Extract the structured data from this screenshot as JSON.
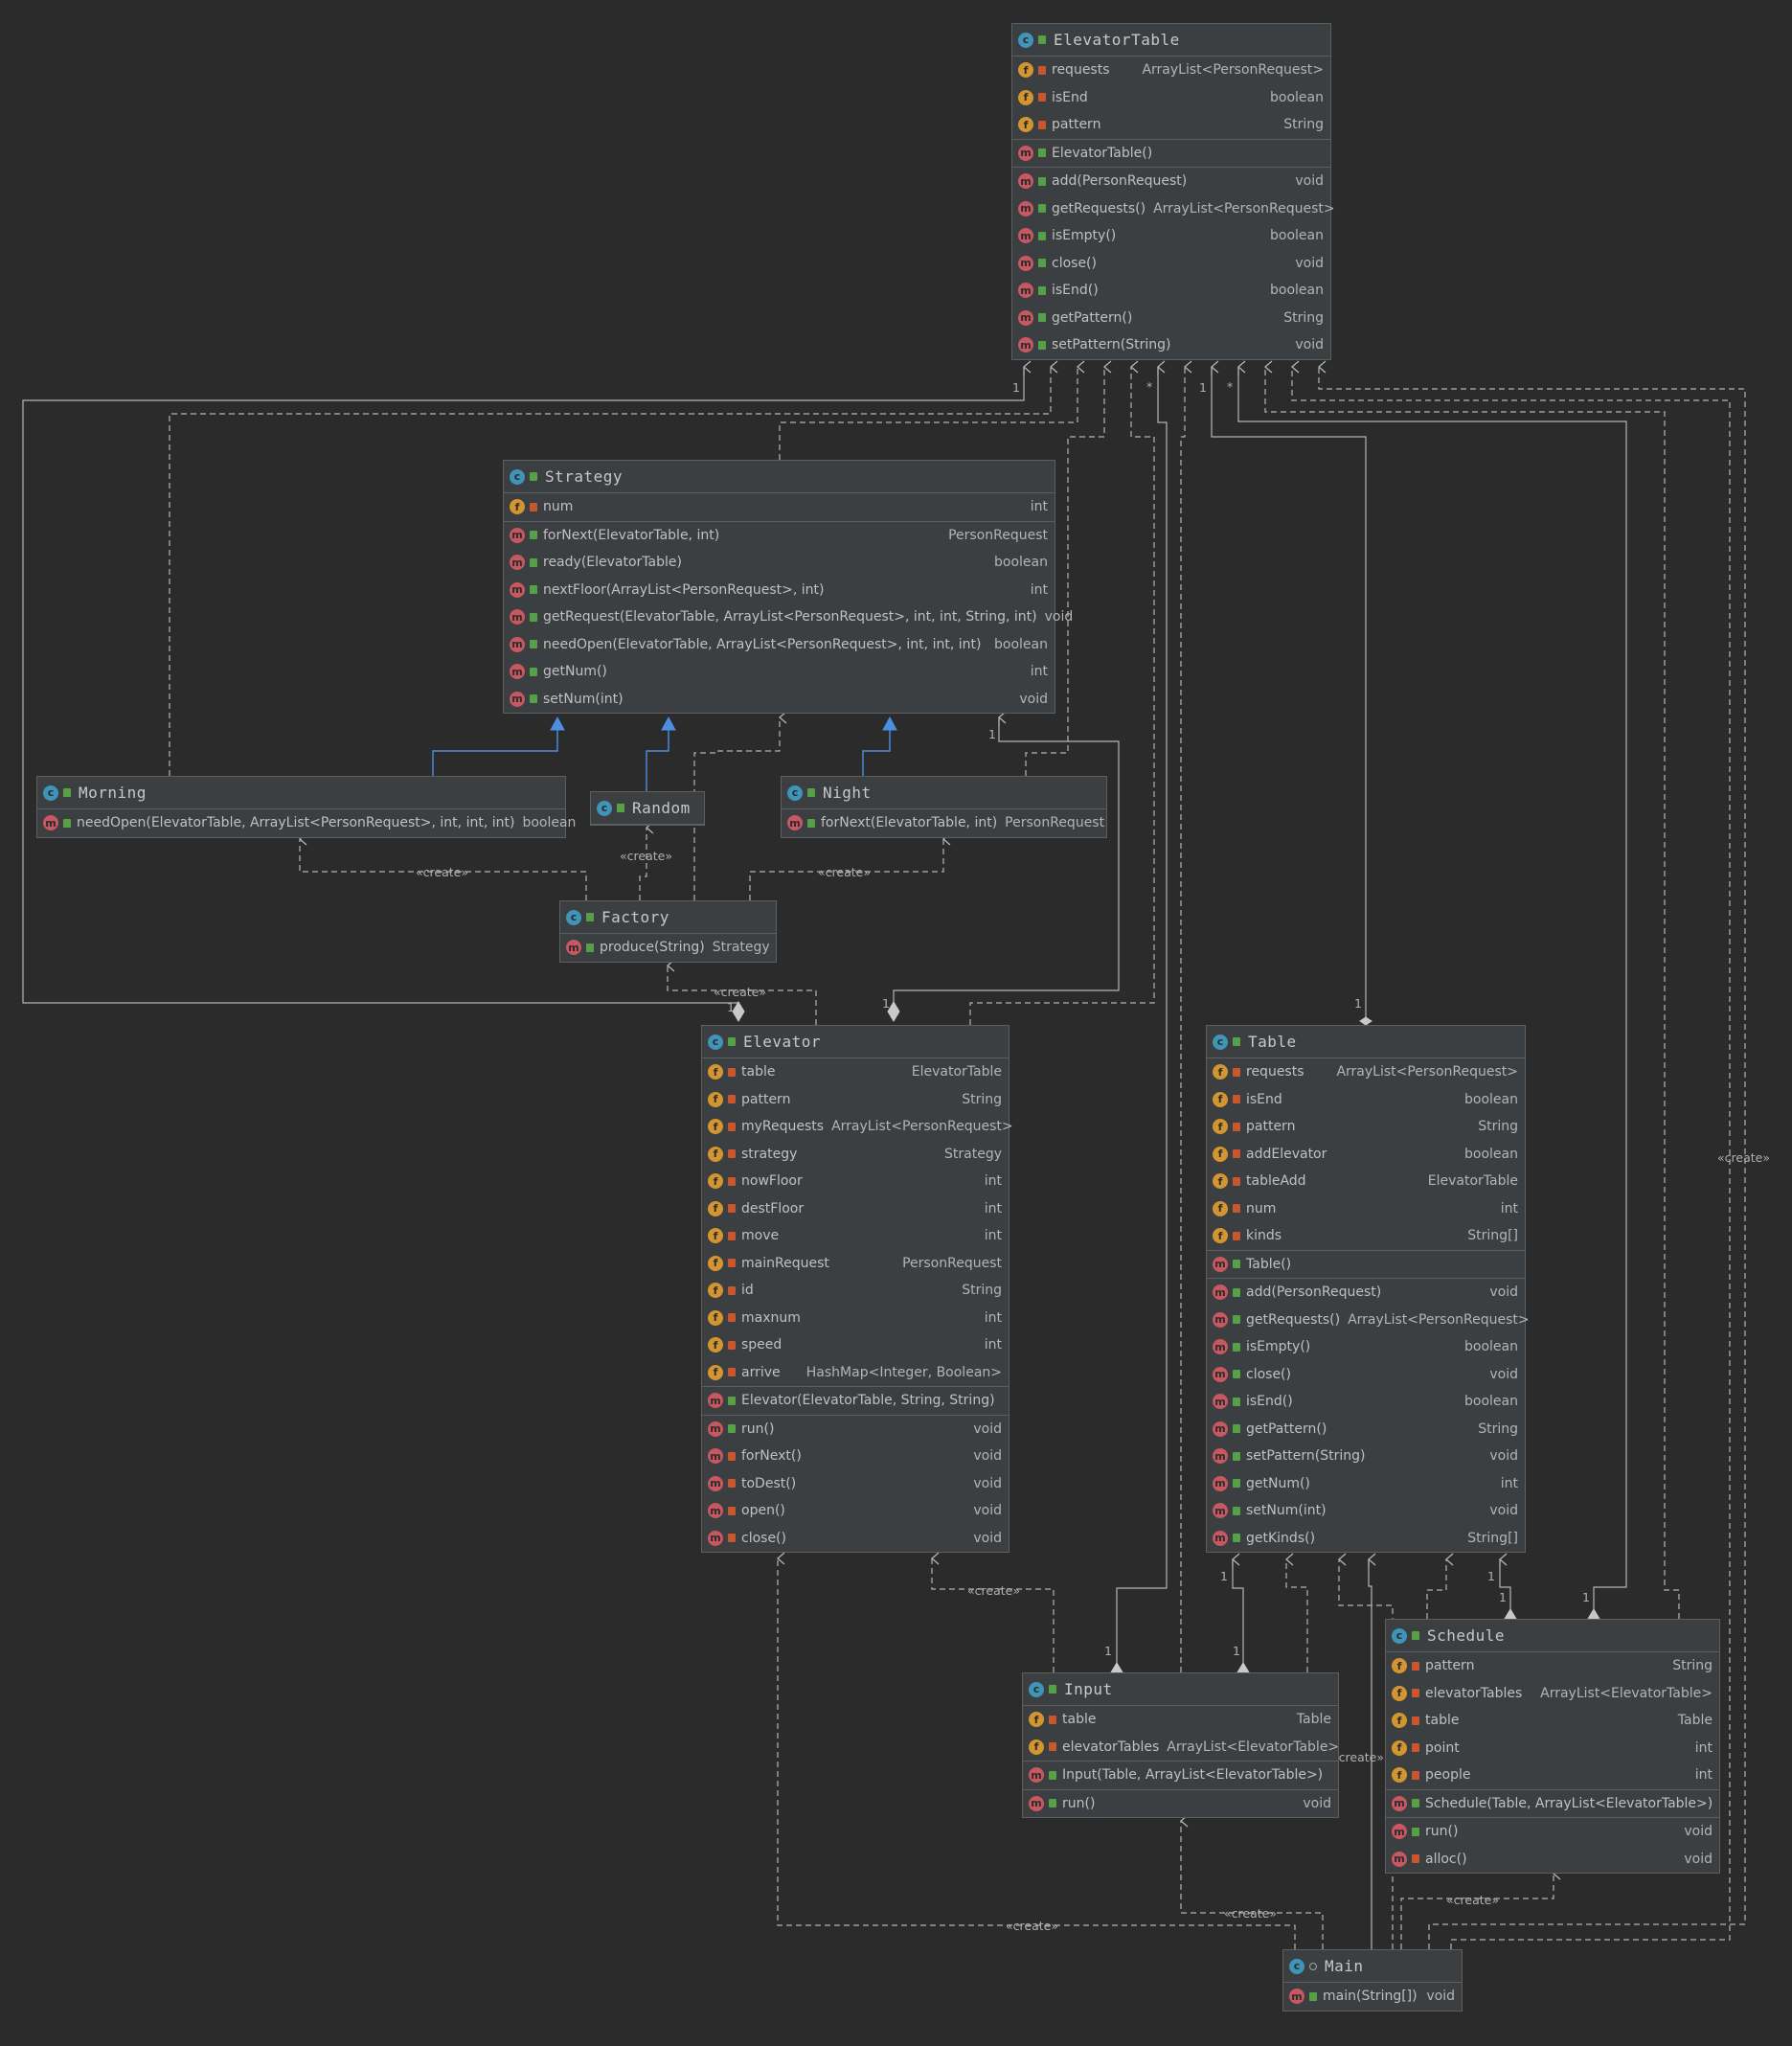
{
  "classes": {
    "elevator_table": {
      "name": "ElevatorTable",
      "fields": [
        {
          "icon": "f",
          "vis": "priv",
          "name": "requests",
          "type": "ArrayList<PersonRequest>"
        },
        {
          "icon": "f",
          "vis": "priv",
          "name": "isEnd",
          "type": "boolean"
        },
        {
          "icon": "f",
          "vis": "priv",
          "name": "pattern",
          "type": "String"
        }
      ],
      "constructors": [
        {
          "icon": "m",
          "vis": "pub",
          "name": "ElevatorTable()",
          "type": ""
        }
      ],
      "methods": [
        {
          "icon": "m",
          "vis": "pub",
          "name": "add(PersonRequest)",
          "type": "void"
        },
        {
          "icon": "m",
          "vis": "pub",
          "name": "getRequests()",
          "type": "ArrayList<PersonRequest>"
        },
        {
          "icon": "m",
          "vis": "pub",
          "name": "isEmpty()",
          "type": "boolean"
        },
        {
          "icon": "m",
          "vis": "pub",
          "name": "close()",
          "type": "void"
        },
        {
          "icon": "m",
          "vis": "pub",
          "name": "isEnd()",
          "type": "boolean"
        },
        {
          "icon": "m",
          "vis": "pub",
          "name": "getPattern()",
          "type": "String"
        },
        {
          "icon": "m",
          "vis": "pub",
          "name": "setPattern(String)",
          "type": "void"
        }
      ]
    },
    "strategy": {
      "name": "Strategy",
      "fields": [
        {
          "icon": "f",
          "vis": "priv",
          "name": "num",
          "type": "int"
        }
      ],
      "methods": [
        {
          "icon": "m",
          "vis": "pub",
          "name": "forNext(ElevatorTable, int)",
          "type": "PersonRequest"
        },
        {
          "icon": "m",
          "vis": "pub",
          "name": "ready(ElevatorTable)",
          "type": "boolean"
        },
        {
          "icon": "m",
          "vis": "pub",
          "name": "nextFloor(ArrayList<PersonRequest>, int)",
          "type": "int"
        },
        {
          "icon": "m",
          "vis": "pub",
          "name": "getRequest(ElevatorTable, ArrayList<PersonRequest>, int, int, String, int)",
          "type": "void"
        },
        {
          "icon": "m",
          "vis": "pub",
          "name": "needOpen(ElevatorTable, ArrayList<PersonRequest>, int, int, int)",
          "type": "boolean"
        },
        {
          "icon": "m",
          "vis": "pub",
          "name": "getNum()",
          "type": "int"
        },
        {
          "icon": "m",
          "vis": "pub",
          "name": "setNum(int)",
          "type": "void"
        }
      ]
    },
    "morning": {
      "name": "Morning",
      "methods": [
        {
          "icon": "m",
          "vis": "pub",
          "name": "needOpen(ElevatorTable, ArrayList<PersonRequest>, int, int, int)",
          "type": "boolean"
        }
      ]
    },
    "random": {
      "name": "Random"
    },
    "night": {
      "name": "Night",
      "methods": [
        {
          "icon": "m",
          "vis": "pub",
          "name": "forNext(ElevatorTable, int)",
          "type": "PersonRequest"
        }
      ]
    },
    "factory": {
      "name": "Factory",
      "methods": [
        {
          "icon": "m",
          "vis": "pub",
          "name": "produce(String)",
          "type": "Strategy"
        }
      ]
    },
    "elevator": {
      "name": "Elevator",
      "fields": [
        {
          "icon": "f",
          "vis": "priv",
          "name": "table",
          "type": "ElevatorTable"
        },
        {
          "icon": "f",
          "vis": "priv",
          "name": "pattern",
          "type": "String"
        },
        {
          "icon": "f",
          "vis": "priv",
          "name": "myRequests",
          "type": "ArrayList<PersonRequest>"
        },
        {
          "icon": "f",
          "vis": "priv",
          "name": "strategy",
          "type": "Strategy"
        },
        {
          "icon": "f",
          "vis": "priv",
          "name": "nowFloor",
          "type": "int"
        },
        {
          "icon": "f",
          "vis": "priv",
          "name": "destFloor",
          "type": "int"
        },
        {
          "icon": "f",
          "vis": "priv",
          "name": "move",
          "type": "int"
        },
        {
          "icon": "f",
          "vis": "priv",
          "name": "mainRequest",
          "type": "PersonRequest"
        },
        {
          "icon": "f",
          "vis": "priv",
          "name": "id",
          "type": "String"
        },
        {
          "icon": "f",
          "vis": "priv",
          "name": "maxnum",
          "type": "int"
        },
        {
          "icon": "f",
          "vis": "priv",
          "name": "speed",
          "type": "int"
        },
        {
          "icon": "f",
          "vis": "priv",
          "name": "arrive",
          "type": "HashMap<Integer, Boolean>"
        }
      ],
      "constructors": [
        {
          "icon": "m",
          "vis": "pub",
          "name": "Elevator(ElevatorTable, String, String)",
          "type": ""
        }
      ],
      "methods": [
        {
          "icon": "m",
          "vis": "pub",
          "name": "run()",
          "type": "void"
        },
        {
          "icon": "m",
          "vis": "priv",
          "name": "forNext()",
          "type": "void"
        },
        {
          "icon": "m",
          "vis": "priv",
          "name": "toDest()",
          "type": "void"
        },
        {
          "icon": "m",
          "vis": "priv",
          "name": "open()",
          "type": "void"
        },
        {
          "icon": "m",
          "vis": "priv",
          "name": "close()",
          "type": "void"
        }
      ]
    },
    "table": {
      "name": "Table",
      "fields": [
        {
          "icon": "f",
          "vis": "priv",
          "name": "requests",
          "type": "ArrayList<PersonRequest>"
        },
        {
          "icon": "f",
          "vis": "priv",
          "name": "isEnd",
          "type": "boolean"
        },
        {
          "icon": "f",
          "vis": "priv",
          "name": "pattern",
          "type": "String"
        },
        {
          "icon": "f",
          "vis": "priv",
          "name": "addElevator",
          "type": "boolean"
        },
        {
          "icon": "f",
          "vis": "priv",
          "name": "tableAdd",
          "type": "ElevatorTable"
        },
        {
          "icon": "f",
          "vis": "priv",
          "name": "num",
          "type": "int"
        },
        {
          "icon": "f",
          "vis": "priv",
          "name": "kinds",
          "type": "String[]"
        }
      ],
      "constructors": [
        {
          "icon": "m",
          "vis": "pub",
          "name": "Table()",
          "type": ""
        }
      ],
      "methods": [
        {
          "icon": "m",
          "vis": "pub",
          "name": "add(PersonRequest)",
          "type": "void"
        },
        {
          "icon": "m",
          "vis": "pub",
          "name": "getRequests()",
          "type": "ArrayList<PersonRequest>"
        },
        {
          "icon": "m",
          "vis": "pub",
          "name": "isEmpty()",
          "type": "boolean"
        },
        {
          "icon": "m",
          "vis": "pub",
          "name": "close()",
          "type": "void"
        },
        {
          "icon": "m",
          "vis": "pub",
          "name": "isEnd()",
          "type": "boolean"
        },
        {
          "icon": "m",
          "vis": "pub",
          "name": "getPattern()",
          "type": "String"
        },
        {
          "icon": "m",
          "vis": "pub",
          "name": "setPattern(String)",
          "type": "void"
        },
        {
          "icon": "m",
          "vis": "pub",
          "name": "getNum()",
          "type": "int"
        },
        {
          "icon": "m",
          "vis": "pub",
          "name": "setNum(int)",
          "type": "void"
        },
        {
          "icon": "m",
          "vis": "pub",
          "name": "getKinds()",
          "type": "String[]"
        }
      ]
    },
    "input": {
      "name": "Input",
      "fields": [
        {
          "icon": "f",
          "vis": "priv",
          "name": "table",
          "type": "Table"
        },
        {
          "icon": "f",
          "vis": "priv",
          "name": "elevatorTables",
          "type": "ArrayList<ElevatorTable>"
        }
      ],
      "constructors": [
        {
          "icon": "m",
          "vis": "pub",
          "name": "Input(Table, ArrayList<ElevatorTable>)",
          "type": ""
        }
      ],
      "methods": [
        {
          "icon": "m",
          "vis": "pub",
          "name": "run()",
          "type": "void"
        }
      ]
    },
    "schedule": {
      "name": "Schedule",
      "fields": [
        {
          "icon": "f",
          "vis": "priv",
          "name": "pattern",
          "type": "String"
        },
        {
          "icon": "f",
          "vis": "priv",
          "name": "elevatorTables",
          "type": "ArrayList<ElevatorTable>"
        },
        {
          "icon": "f",
          "vis": "priv",
          "name": "table",
          "type": "Table"
        },
        {
          "icon": "f",
          "vis": "priv",
          "name": "point",
          "type": "int"
        },
        {
          "icon": "f",
          "vis": "priv",
          "name": "people",
          "type": "int"
        }
      ],
      "constructors": [
        {
          "icon": "m",
          "vis": "pub",
          "name": "Schedule(Table, ArrayList<ElevatorTable>)",
          "type": ""
        }
      ],
      "methods": [
        {
          "icon": "m",
          "vis": "pub",
          "name": "run()",
          "type": "void"
        },
        {
          "icon": "m",
          "vis": "priv",
          "name": "alloc()",
          "type": "void"
        }
      ]
    },
    "main": {
      "name": "Main",
      "methods": [
        {
          "icon": "m",
          "vis": "pub",
          "name": "main(String[])",
          "type": "void"
        }
      ]
    }
  },
  "edge_labels": {
    "create": "«create»",
    "one": "1",
    "many": "*"
  },
  "colors": {
    "background": "#2b2b2b",
    "class_fill": "#3c3f41",
    "border": "#5e6060",
    "edge": "#b4b4b4",
    "inheritance": "#4c8fe0",
    "class_icon": "#3f94b8",
    "field_icon": "#d3952f",
    "method_icon": "#c75760"
  }
}
